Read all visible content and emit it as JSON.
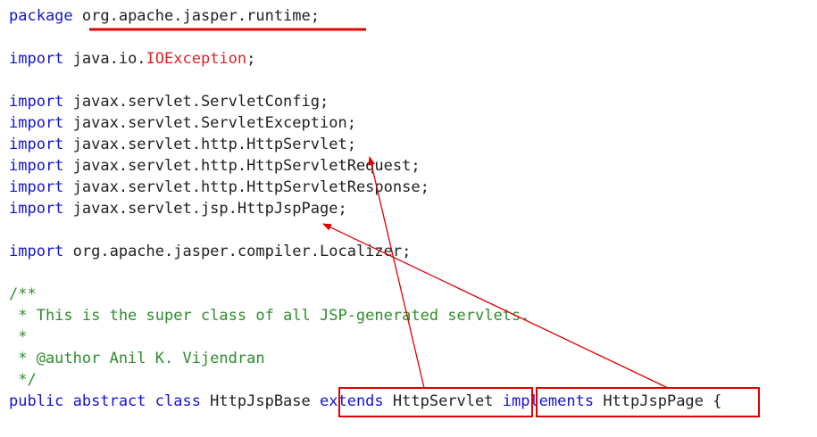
{
  "code_lines": [
    [
      {
        "t": "package",
        "c": "keyword"
      },
      {
        "t": " org.apache.jasper.runtime;",
        "c": "plain"
      }
    ],
    [],
    [
      {
        "t": "import",
        "c": "keyword"
      },
      {
        "t": " java.io.",
        "c": "plain"
      },
      {
        "t": "IOException",
        "c": "class"
      },
      {
        "t": ";",
        "c": "plain"
      }
    ],
    [],
    [
      {
        "t": "import",
        "c": "keyword"
      },
      {
        "t": " javax.servlet.ServletConfig;",
        "c": "plain"
      }
    ],
    [
      {
        "t": "import",
        "c": "keyword"
      },
      {
        "t": " javax.servlet.ServletException;",
        "c": "plain"
      }
    ],
    [
      {
        "t": "import",
        "c": "keyword"
      },
      {
        "t": " javax.servlet.http.HttpServlet;",
        "c": "plain"
      }
    ],
    [
      {
        "t": "import",
        "c": "keyword"
      },
      {
        "t": " javax.servlet.http.HttpServletRequest;",
        "c": "plain"
      }
    ],
    [
      {
        "t": "import",
        "c": "keyword"
      },
      {
        "t": " javax.servlet.http.HttpServletResponse;",
        "c": "plain"
      }
    ],
    [
      {
        "t": "import",
        "c": "keyword"
      },
      {
        "t": " javax.servlet.jsp.HttpJspPage;",
        "c": "plain"
      }
    ],
    [],
    [
      {
        "t": "import",
        "c": "keyword"
      },
      {
        "t": " org.apache.jasper.compiler.Localizer;",
        "c": "plain"
      }
    ],
    [],
    [
      {
        "t": "/**",
        "c": "comment"
      }
    ],
    [
      {
        "t": " * This is the super class of all JSP-generated servlets.",
        "c": "comment"
      }
    ],
    [
      {
        "t": " *",
        "c": "comment"
      }
    ],
    [
      {
        "t": " * @author Anil K. Vijendran",
        "c": "comment"
      }
    ],
    [
      {
        "t": " */",
        "c": "comment"
      }
    ],
    [
      {
        "t": "public abstract class",
        "c": "keyword"
      },
      {
        "t": " HttpJspBase ",
        "c": "plain"
      },
      {
        "t": "extends",
        "c": "keyword"
      },
      {
        "t": " HttpServlet ",
        "c": "plain"
      },
      {
        "t": "implements",
        "c": "keyword"
      },
      {
        "t": " HttpJspPage ",
        "c": "plain"
      },
      {
        "t": "{",
        "c": "plain"
      }
    ]
  ],
  "colors": {
    "keyword": "#1414d4",
    "plain": "#1f1f1f",
    "class": "#dd2222",
    "comment": "#2e8b2e",
    "annotation": "#e00000"
  }
}
